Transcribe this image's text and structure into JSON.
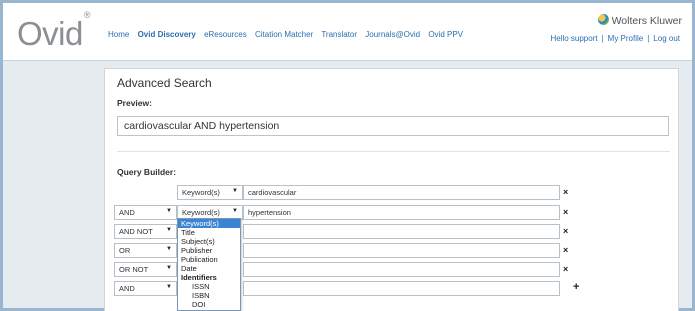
{
  "header": {
    "logo": "Ovid",
    "logo_mark": "®",
    "nav": [
      "Home",
      "Ovid Discovery",
      "eResources",
      "Citation Matcher",
      "Translator",
      "Journals@Ovid",
      "Ovid PPV"
    ],
    "brand": "Wolters Kluwer",
    "greeting": "Hello support",
    "my_profile": "My Profile",
    "logout": "Log out",
    "separator": "|"
  },
  "panel": {
    "title": "Advanced Search",
    "preview_label": "Preview:",
    "preview_text": "cardiovascular AND hypertension",
    "query_builder_label": "Query Builder:"
  },
  "rows": [
    {
      "bool": "",
      "field": "Keyword(s)",
      "term": "cardiovascular",
      "action": "×"
    },
    {
      "bool": "AND",
      "field": "Keyword(s)",
      "term": "hypertension",
      "action": "×"
    },
    {
      "bool": "AND NOT",
      "field": "",
      "term": "",
      "action": "×"
    },
    {
      "bool": "OR",
      "field": "",
      "term": "",
      "action": "×"
    },
    {
      "bool": "OR NOT",
      "field": "",
      "term": "",
      "action": "×"
    },
    {
      "bool": "AND",
      "field": "",
      "term": "",
      "action": "+"
    }
  ],
  "dropdown": {
    "options": [
      {
        "label": "Keyword(s)",
        "kind": "selected"
      },
      {
        "label": "Title",
        "kind": "option"
      },
      {
        "label": "Subject(s)",
        "kind": "option"
      },
      {
        "label": "Publisher",
        "kind": "option"
      },
      {
        "label": "Publication",
        "kind": "option"
      },
      {
        "label": "Date",
        "kind": "option"
      },
      {
        "label": "Identifiers",
        "kind": "group"
      },
      {
        "label": "ISSN",
        "kind": "indent"
      },
      {
        "label": "ISBN",
        "kind": "indent"
      },
      {
        "label": "DOI",
        "kind": "indent"
      }
    ]
  },
  "icons": {
    "arrow": "▼",
    "globe": "globe-icon"
  },
  "colors": {
    "link": "#2a6fb0",
    "frame": "#98b6d0",
    "selected": "#3b84d4"
  }
}
